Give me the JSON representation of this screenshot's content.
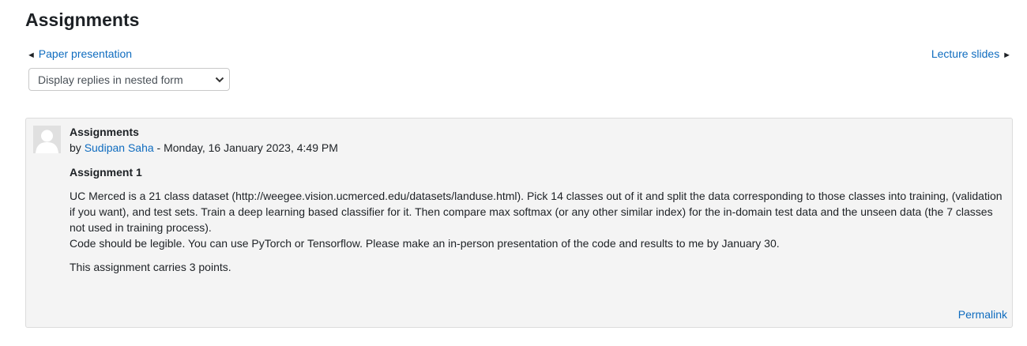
{
  "page": {
    "title": "Assignments"
  },
  "navigation": {
    "prev_arrow": "◄",
    "prev_label": "Paper presentation",
    "next_label": "Lecture slides",
    "next_arrow": "►"
  },
  "display_mode": {
    "selected": "Display replies in nested form"
  },
  "post": {
    "subject": "Assignments",
    "by_prefix": "by ",
    "author": "Sudipan Saha",
    "date_text": " - Monday, 16 January 2023, 4:49 PM",
    "body_heading": "Assignment 1",
    "body_paragraph_1": "UC Merced is a 21 class dataset (http://weegee.vision.ucmerced.edu/datasets/landuse.html). Pick 14 classes out of it and split the data corresponding to those classes into training, (validation if you want), and test sets. Train a deep learning based classifier for it.  Then compare max softmax (or any other similar index) for the in-domain test data and the unseen data (the 7 classes not used in training process).",
    "body_paragraph_2": "Code should be legible. You can use PyTorch or Tensorflow. Please make an in-person presentation of the code and results to me by January 30.",
    "body_paragraph_3": "This assignment carries 3 points.",
    "permalink_label": "Permalink"
  },
  "colors": {
    "link": "#0f6cbf",
    "post_background": "#f4f4f4",
    "text": "#1d2125"
  }
}
